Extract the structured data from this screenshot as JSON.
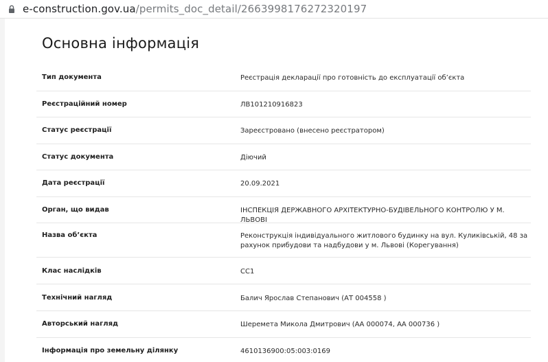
{
  "browser": {
    "url_host": "e-construction.gov.ua",
    "url_path": "/permits_doc_detail/2663998176272320197"
  },
  "section": {
    "title": "Основна інформація"
  },
  "rows": [
    {
      "label": "Тип документа",
      "value": "Реєстрація декларації про готовність до експлуатації об’єкта"
    },
    {
      "label": "Реєстраційний номер",
      "value": "ЛВ101210916823"
    },
    {
      "label": "Статус реєстрації",
      "value": "Зареєстровано (внесено реєстратором)"
    },
    {
      "label": "Статус документа",
      "value": "Діючий"
    },
    {
      "label": "Дата реєстрації",
      "value": "20.09.2021"
    },
    {
      "label": "Орган, що видав",
      "value": "ІНСПЕКЦІЯ ДЕРЖАВНОГО АРХІТЕКТУРНО-БУДІВЕЛЬНОГО КОНТРОЛЮ У М. ЛЬВОВІ"
    },
    {
      "label": "Назва об’єкта",
      "value": "Реконструкція індивідуального житлового будинку на вул. Куликівській, 48 за рахунок прибудови та надбудови у м. Львові (Корегування)"
    },
    {
      "label": "Клас наслідків",
      "value": "СС1"
    },
    {
      "label": "Технічний нагляд",
      "value": "Балич Ярослав Степанович (АТ 004558 )"
    },
    {
      "label": "Авторський нагляд",
      "value": "Шеремета Микола Дмитрович (АА 000074, АА 000736 )"
    },
    {
      "label": "Інформація про земельну ділянку",
      "value": "4610136900:05:003:0169"
    }
  ]
}
